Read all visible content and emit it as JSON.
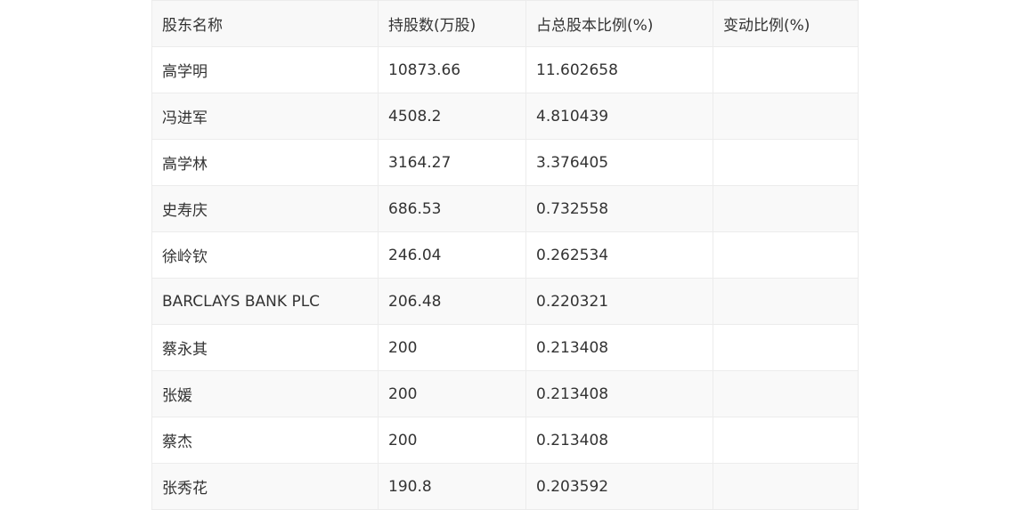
{
  "table": {
    "headers": [
      "股东名称",
      "持股数(万股)",
      "占总股本比例(%)",
      "变动比例(%)"
    ],
    "rows": [
      [
        "高学明",
        "10873.66",
        "11.602658",
        ""
      ],
      [
        "冯进军",
        "4508.2",
        "4.810439",
        ""
      ],
      [
        "高学林",
        "3164.27",
        "3.376405",
        ""
      ],
      [
        "史寿庆",
        "686.53",
        "0.732558",
        ""
      ],
      [
        "徐岭钦",
        "246.04",
        "0.262534",
        ""
      ],
      [
        "BARCLAYS BANK PLC",
        "206.48",
        "0.220321",
        ""
      ],
      [
        "蔡永其",
        "200",
        "0.213408",
        ""
      ],
      [
        "张媛",
        "200",
        "0.213408",
        ""
      ],
      [
        "蔡杰",
        "200",
        "0.213408",
        ""
      ],
      [
        "张秀花",
        "190.8",
        "0.203592",
        ""
      ]
    ]
  }
}
